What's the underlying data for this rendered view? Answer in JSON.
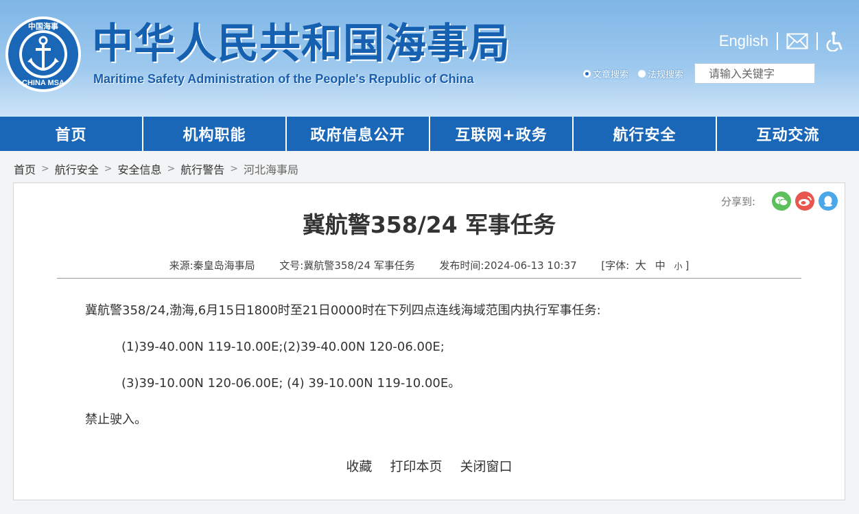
{
  "header": {
    "title_cn": "中华人民共和国海事局",
    "title_en": "Maritime Safety Administration of the People's Republic of China",
    "logo_top_text": "中国海事",
    "logo_bottom_text": "CHINA MSA",
    "lang_link": "English",
    "mail_icon": "mail-icon",
    "accessibility_icon": "accessibility-icon",
    "search": {
      "option_articles": "文章搜索",
      "option_laws": "法规搜索",
      "selected": "文章搜索",
      "placeholder": "请输入关键字"
    }
  },
  "nav": {
    "items": [
      {
        "label": "首页"
      },
      {
        "label": "机构职能"
      },
      {
        "label": "政府信息公开"
      },
      {
        "label": "互联网+政务"
      },
      {
        "label": "航行安全"
      },
      {
        "label": "互动交流"
      }
    ]
  },
  "breadcrumb": {
    "items": [
      "首页",
      "航行安全",
      "安全信息",
      "航行警告",
      "河北海事局"
    ],
    "separator": ">"
  },
  "share": {
    "label": "分享到:",
    "icons": [
      "wechat-icon",
      "weibo-icon",
      "qq-icon"
    ],
    "colors": {
      "wechat": "#5cc05c",
      "weibo": "#e8574f",
      "qq": "#4aa7e8"
    }
  },
  "article": {
    "title": "冀航警358/24 军事任务",
    "meta": {
      "source_label": "来源:",
      "source": "秦皇岛海事局",
      "docno_label": "文号:",
      "docno": "冀航警358/24 军事任务",
      "date_label": "发布时间:",
      "date": "2024-06-13 10:37",
      "fontsize_label": "[字体:",
      "fontsize_big": "大",
      "fontsize_mid": "中",
      "fontsize_small": "小",
      "fontsize_end": "]"
    },
    "paragraphs": [
      "冀航警358/24,渤海,6月15日1800时至21日0000时在下列四点连线海域范围内执行军事任务:",
      "(1)39-40.00N 119-10.00E;(2)39-40.00N 120-06.00E;",
      "(3)39-10.00N 120-06.00E; (4) 39-10.00N 119-10.00E。",
      "禁止驶入。"
    ]
  },
  "actions": {
    "favorite": "收藏",
    "print": "打印本页",
    "close": "关闭窗口"
  },
  "colors": {
    "nav_bg": "#1a66b7",
    "title_blue": "#1560b0"
  }
}
